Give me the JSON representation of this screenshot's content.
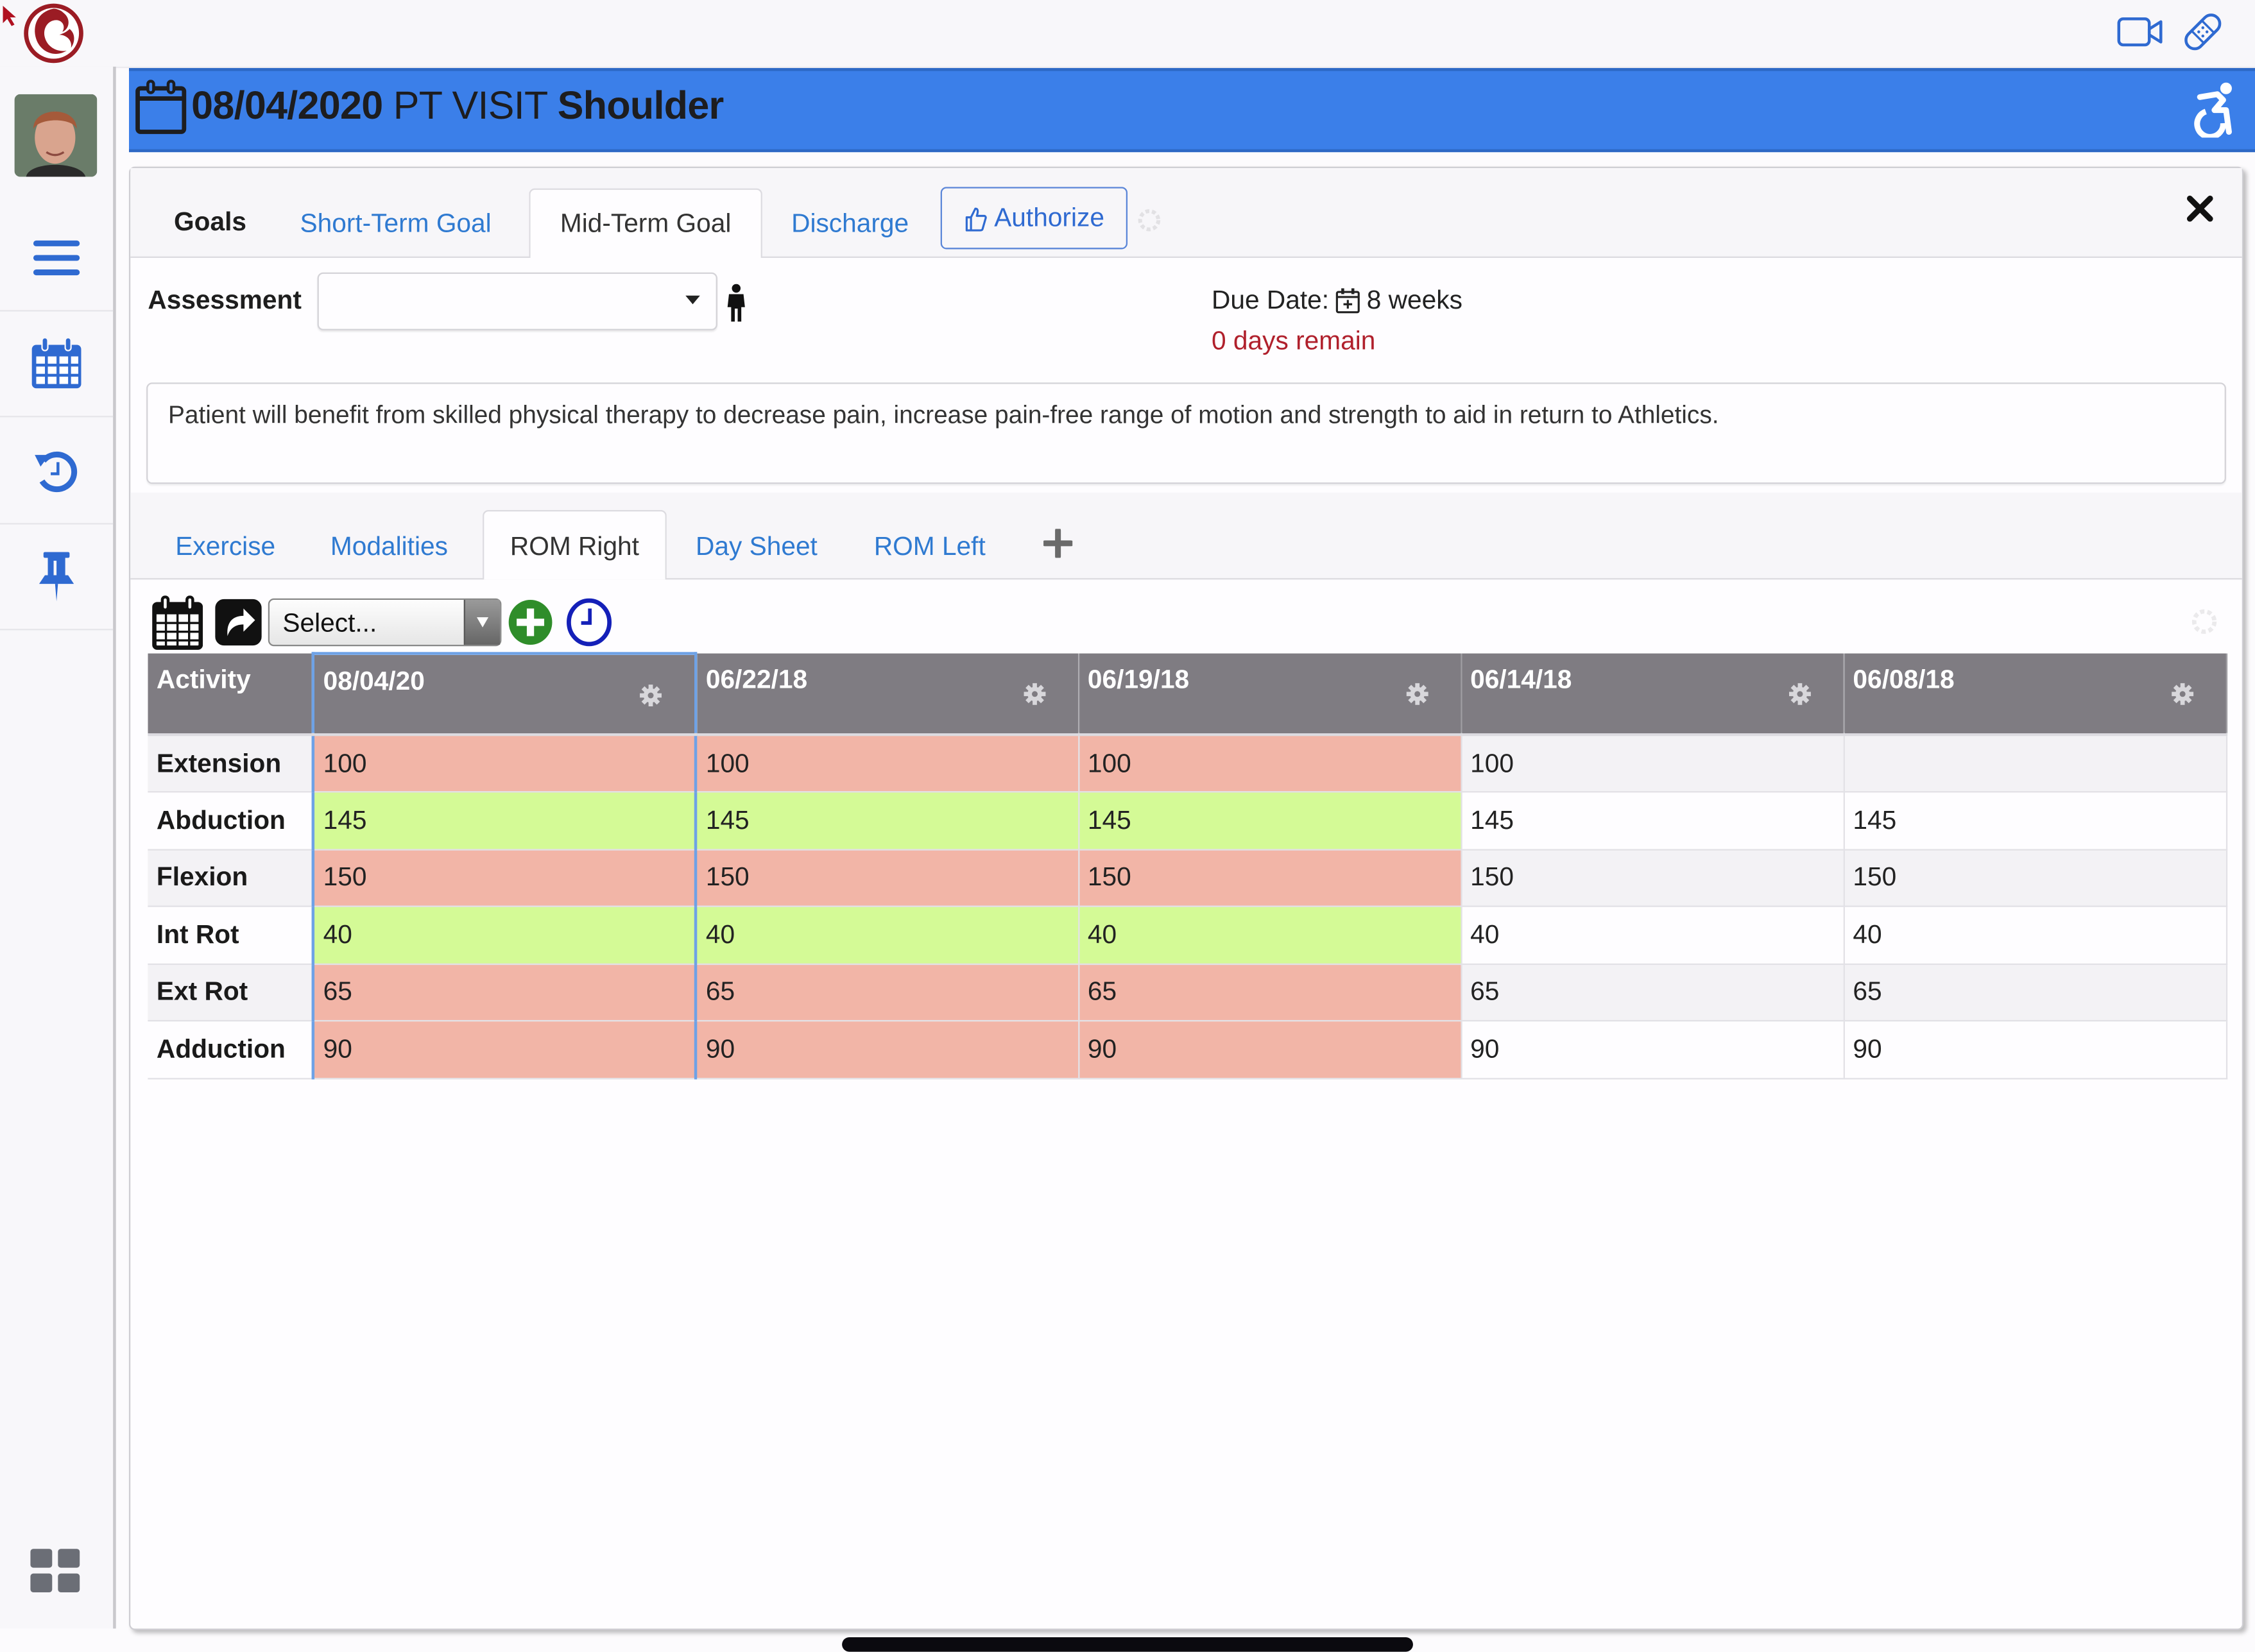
{
  "header": {
    "date": "08/04/2020",
    "visit_type": " PT VISIT ",
    "body_part": "Shoulder"
  },
  "topbar": {
    "icons": [
      "app-logo-icon",
      "video-camera-icon",
      "bandage-icon"
    ]
  },
  "sidebar": {
    "items": [
      {
        "icon": "menu-icon",
        "label": "Menu"
      },
      {
        "icon": "calendar-icon",
        "label": "Calendar"
      },
      {
        "icon": "history-icon",
        "label": "History"
      },
      {
        "icon": "pin-icon",
        "label": "Pin"
      }
    ],
    "bottom_icon": "grid-icon"
  },
  "goals": {
    "label": "Goals",
    "tabs": [
      {
        "label": "Short-Term Goal",
        "active": false
      },
      {
        "label": "Mid-Term Goal",
        "active": true
      },
      {
        "label": "Discharge",
        "active": false
      }
    ],
    "authorize_label": "Authorize",
    "assessment_label": "Assessment",
    "assessment_value": "",
    "due_date_label": "Due Date:",
    "due_date_value": "8 weeks",
    "days_remain": "0 days remain",
    "goal_text": "Patient will benefit from skilled physical therapy to decrease pain, increase pain-free range of motion and strength to aid in return to Athletics."
  },
  "sub_tabs": [
    {
      "label": "Exercise",
      "active": false
    },
    {
      "label": "Modalities",
      "active": false
    },
    {
      "label": "ROM Right",
      "active": true
    },
    {
      "label": "Day Sheet",
      "active": false
    },
    {
      "label": "ROM Left",
      "active": false
    }
  ],
  "toolbar": {
    "select_placeholder": "Select..."
  },
  "colors": {
    "header_blue": "#3b7fe9",
    "link_blue": "#2f7ad1",
    "alert_red": "#b0202c",
    "cell_red": "#f2b5a7",
    "cell_green": "#d4fa96",
    "table_header_gray": "#7f7c82"
  },
  "rom_table": {
    "activity_header": "Activity",
    "columns": [
      "08/04/20",
      "06/22/18",
      "06/19/18",
      "06/14/18",
      "06/08/18"
    ],
    "selected_column": 0,
    "rows": [
      {
        "activity": "Extension",
        "values": [
          "100",
          "100",
          "100",
          "100",
          ""
        ],
        "status": [
          "red",
          "red",
          "red",
          "",
          ""
        ]
      },
      {
        "activity": "Abduction",
        "values": [
          "145",
          "145",
          "145",
          "145",
          "145"
        ],
        "status": [
          "green",
          "green",
          "green",
          "",
          ""
        ]
      },
      {
        "activity": "Flexion",
        "values": [
          "150",
          "150",
          "150",
          "150",
          "150"
        ],
        "status": [
          "red",
          "red",
          "red",
          "",
          ""
        ]
      },
      {
        "activity": "Int Rot",
        "values": [
          "40",
          "40",
          "40",
          "40",
          "40"
        ],
        "status": [
          "green",
          "green",
          "green",
          "",
          ""
        ]
      },
      {
        "activity": "Ext Rot",
        "values": [
          "65",
          "65",
          "65",
          "65",
          "65"
        ],
        "status": [
          "red",
          "red",
          "red",
          "",
          ""
        ]
      },
      {
        "activity": "Adduction",
        "values": [
          "90",
          "90",
          "90",
          "90",
          "90"
        ],
        "status": [
          "red",
          "red",
          "red",
          "",
          ""
        ]
      }
    ]
  }
}
